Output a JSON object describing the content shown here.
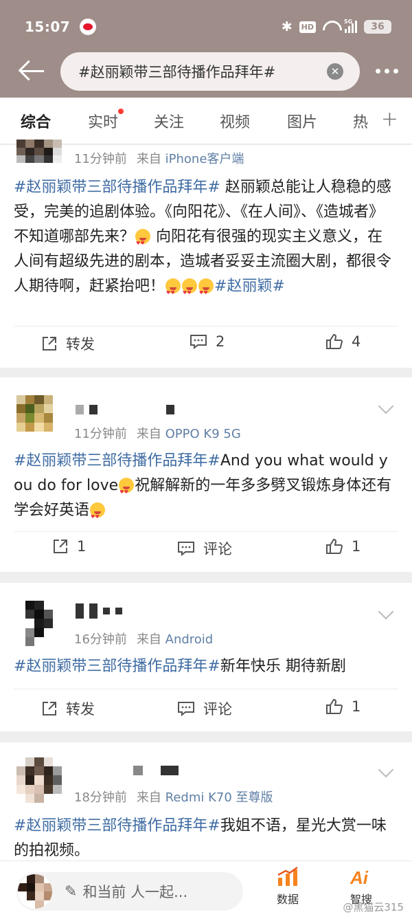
{
  "status_bar": {
    "time": "15:07",
    "battery": "36",
    "network": "5G"
  },
  "header": {
    "search_query": "#赵丽颖带三部待播作品拜年#"
  },
  "tabs": [
    "综合",
    "实时",
    "关注",
    "视频",
    "图片",
    "热"
  ],
  "posts": [
    {
      "time": "11分钟前",
      "from_label": "来自",
      "source": "iPhone客户端",
      "body_parts": [
        {
          "t": "tag",
          "v": "#赵丽颖带三部待播作品拜年#"
        },
        {
          "t": "txt",
          "v": " 赵丽颖总能让人稳稳的感受，完美的追剧体验。《向阳花》、《在人间》、《造城者》不知道哪部先来？"
        },
        {
          "t": "txt",
          "v": " 向阳花有很强的现实主义意义，在人间有超级先进的剧本，造城者妥妥主流圈大剧，都很令人期待啊，赶紧抬吧！"
        },
        {
          "t": "tag",
          "v": "#赵丽颖#"
        }
      ],
      "repost": "转发",
      "comment": "2",
      "like": "4"
    },
    {
      "time": "11分钟前",
      "from_label": "来自",
      "source": "OPPO K9 5G",
      "tag": "#赵丽颖带三部待播作品拜年#",
      "text1": "And you what would you do for love",
      "text2": "祝解解新的一年多多劈叉锻炼身体还有学会好英语",
      "repost": "1",
      "comment": "评论",
      "like": "1"
    },
    {
      "time": "16分钟前",
      "from_label": "来自",
      "source": "Android",
      "tag": "#赵丽颖带三部待播作品拜年#",
      "text": "新年快乐  期待新剧",
      "repost": "转发",
      "comment": "评论",
      "like": "1"
    },
    {
      "time": "18分钟前",
      "from_label": "来自",
      "source": "Redmi K70 至尊版",
      "tag": "#赵丽颖带三部待播作品拜年#",
      "text": "我姐不语，星光大赏一味的拍视频。"
    }
  ],
  "bottom_bar": {
    "placeholder": "和当前        人一起...",
    "data_label": "数据",
    "ai_label": "智搜",
    "watermark": "@黑猫云315"
  },
  "colors": {
    "header_bg": "#9e8d88",
    "topic_blue": "#3f6ca3",
    "source_blue": "#5f7fa5",
    "notification_red": "#ff3b30",
    "accent_orange": "#f7831f"
  }
}
